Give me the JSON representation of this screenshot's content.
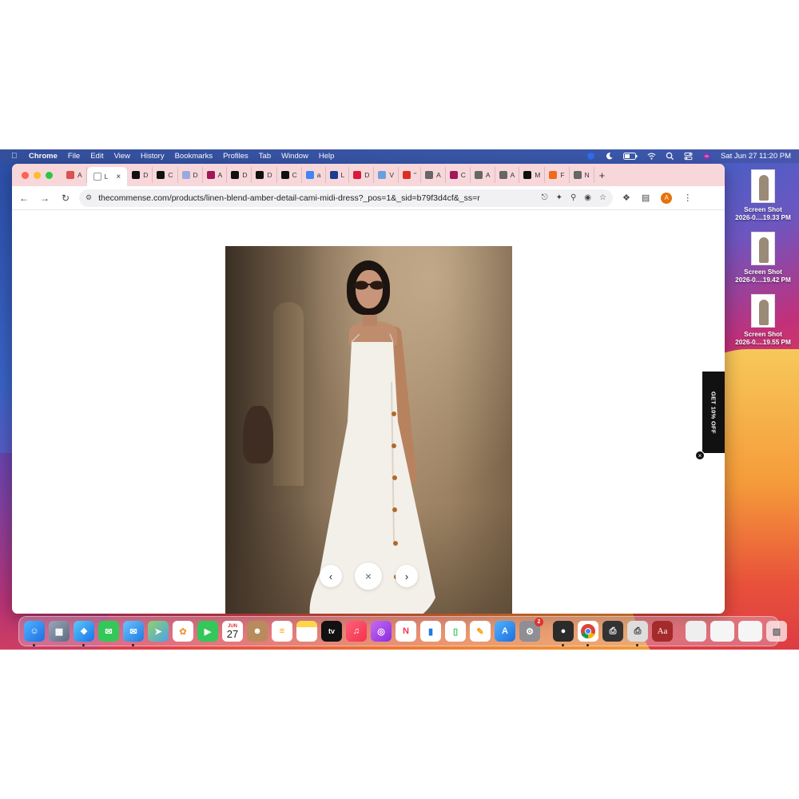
{
  "menubar": {
    "app_name": "Chrome",
    "menus": [
      "File",
      "Edit",
      "View",
      "History",
      "Bookmarks",
      "Profiles",
      "Tab",
      "Window",
      "Help"
    ],
    "datetime": "Sat Jun 27  11:20 PM"
  },
  "tabs": [
    {
      "label": "A",
      "icon": "grid-icon",
      "color": "#d9534f"
    },
    {
      "label": "L",
      "icon": "lune-icon",
      "color": "#ffffff",
      "active": true
    },
    {
      "label": "D",
      "icon": "s-logo-icon",
      "color": "#111111"
    },
    {
      "label": "C",
      "icon": "f-logo-icon",
      "color": "#111111"
    },
    {
      "label": "D",
      "icon": "dots-icon",
      "color": "#9ad"
    },
    {
      "label": "A",
      "icon": "f-logo-icon",
      "color": "#a0185a"
    },
    {
      "label": "D",
      "icon": "f-logo-icon",
      "color": "#111111"
    },
    {
      "label": "D",
      "icon": "c-logo-icon",
      "color": "#111111"
    },
    {
      "label": "C",
      "icon": "c-logo-icon",
      "color": "#111111"
    },
    {
      "label": "a",
      "icon": "google-icon",
      "color": "#4285f4"
    },
    {
      "label": "L",
      "icon": "pentagon-icon",
      "color": "#1a3d8f"
    },
    {
      "label": "D",
      "icon": "d-logo-icon",
      "color": "#d81b3c"
    },
    {
      "label": "V",
      "icon": "v-logo-icon",
      "color": "#6aa0e0"
    },
    {
      "label": "\"",
      "icon": "gmail-icon",
      "color": "#d93025"
    },
    {
      "label": "A",
      "icon": "globe-icon",
      "color": "#666666"
    },
    {
      "label": "C",
      "icon": "f-logo-icon",
      "color": "#a0185a"
    },
    {
      "label": "A",
      "icon": "globe-icon",
      "color": "#666666"
    },
    {
      "label": "A",
      "icon": "globe-icon",
      "color": "#666666"
    },
    {
      "label": "M",
      "icon": "bag-icon",
      "color": "#111111"
    },
    {
      "label": "F",
      "icon": "orange-square-icon",
      "color": "#f06a1d"
    },
    {
      "label": "N",
      "icon": "chrome-icon",
      "color": "#666666"
    }
  ],
  "toolbar": {
    "url": "thecommense.com/products/linen-blend-amber-detail-cami-midi-dress?_pos=1&_sid=b79f3d4cf&_ss=r",
    "profile_initial": "A"
  },
  "lightbox": {
    "prev": "‹",
    "close": "×",
    "next": "›"
  },
  "promo": {
    "label": "GET 10% OFF",
    "close": "×"
  },
  "desktop_files": [
    {
      "name": "Screen Shot",
      "date": "2026-0....19.33 PM"
    },
    {
      "name": "Screen Shot",
      "date": "2026-0....19.42 PM"
    },
    {
      "name": "Screen Shot",
      "date": "2026-0....19.55 PM"
    }
  ],
  "dock": {
    "calendar_month": "JUN",
    "calendar_day": "27",
    "tv_label": "tv",
    "dictionary_label": "Aa",
    "settings_badge": "2"
  }
}
